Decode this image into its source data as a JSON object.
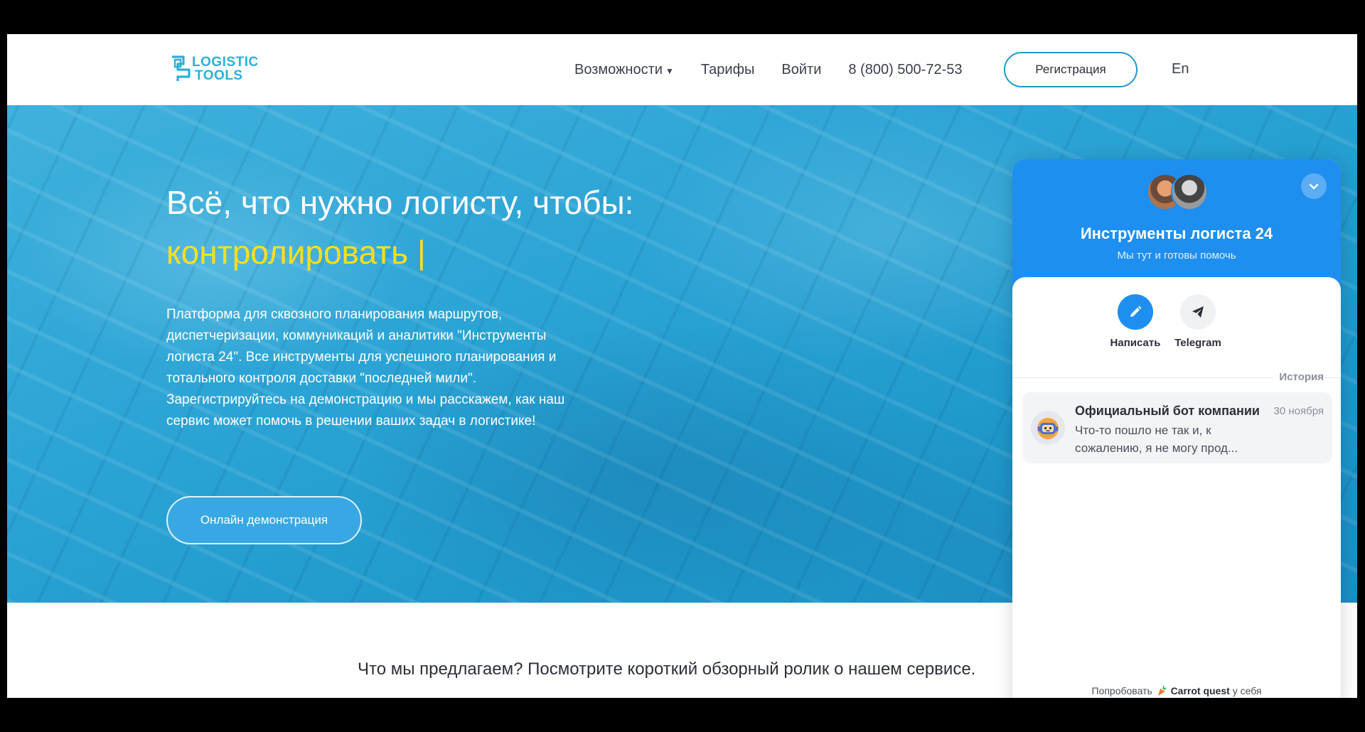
{
  "header": {
    "logo_line1": "LOGISTIC",
    "logo_line2": "TOOLS",
    "nav": {
      "features": "Возможности",
      "pricing": "Тарифы",
      "login": "Войти",
      "phone": "8 (800) 500-72-53"
    },
    "register_label": "Регистрация",
    "lang_label": "En"
  },
  "hero": {
    "title": "Всё, что нужно логисту, чтобы:",
    "rotating_text": "контролировать |",
    "description": "Платформа для сквозного планирования маршрутов, диспетчеризации, коммуникаций и аналитики \"Инструменты логиста 24\". Все инструменты для успешного планирования и тотального контроля доставки \"последней мили\". Зарегистрируйтесь на демонстрацию и мы расскажем, как наш сервис может помочь в решении ваших задач в логистике!",
    "demo_button": "Онлайн демонстрация"
  },
  "below": {
    "text": "Что мы предлагаем? Посмотрите короткий обзорный ролик о нашем сервисе."
  },
  "chat": {
    "title": "Инструменты логиста 24",
    "subtitle": "Мы тут и готовы помочь",
    "actions": {
      "write": "Написать",
      "telegram": "Telegram"
    },
    "history_label": "История",
    "conversation": {
      "name": "Официальный бот компании",
      "date": "30 ноября",
      "message": "Что-то пошло не так и, к сожалению, я не могу прод..."
    },
    "footer": {
      "prefix": "Попробовать",
      "brand": "Carrot quest",
      "suffix": "у себя"
    }
  },
  "colors": {
    "accent": "#1e8ff0",
    "hero_highlight": "#ffdf1b",
    "logo": "#2bb0d8"
  },
  "icons": {
    "pencil": "pencil-icon",
    "telegram": "telegram-icon",
    "chevron": "chevron-down-icon",
    "bot": "bot-icon",
    "carrot": "carrot-icon"
  }
}
